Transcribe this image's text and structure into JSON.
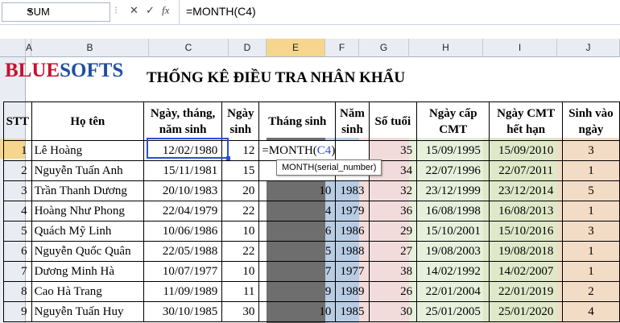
{
  "formula_bar": {
    "name_box": "SUM",
    "formula": "=MONTH(C4)",
    "icons": [
      "cancel-icon",
      "enter-icon",
      "function-icon"
    ]
  },
  "columns": [
    "A",
    "B",
    "C",
    "D",
    "E",
    "F",
    "G",
    "H",
    "I",
    "J"
  ],
  "selected_column": "E",
  "logo": {
    "part1": "BLUE",
    "part2": "SOFTS"
  },
  "title": "THỐNG KÊ ĐIỀU TRA NHÂN KHẨU",
  "headers": {
    "stt": "STT",
    "ho_ten": "Họ tên",
    "ngay_sinh_full": "Ngày, tháng, năm sinh",
    "ngay_sinh": "Ngày sinh",
    "thang_sinh": "Tháng sinh",
    "nam_sinh": "Năm sinh",
    "so_tuoi": "Số tuổi",
    "ngay_cap": "Ngày cấp CMT",
    "ngay_het_han": "Ngày CMT hết hạn",
    "sinh_vao_ngay": "Sinh vào ngày"
  },
  "rows": [
    {
      "stt": "1",
      "name": "Lê Hoàng",
      "dob": "12/02/1980",
      "day": "12",
      "month": "=MONTH(C4)",
      "year": "",
      "age": "35",
      "issue": "15/09/1995",
      "expire": "15/09/2010",
      "weekday": "3"
    },
    {
      "stt": "2",
      "name": "Nguyễn Tuấn Anh",
      "dob": "15/11/1981",
      "day": "15",
      "month": "",
      "year": "",
      "age": "34",
      "issue": "22/07/1996",
      "expire": "22/07/2011",
      "weekday": "1"
    },
    {
      "stt": "3",
      "name": "Trần Thanh Dương",
      "dob": "20/10/1983",
      "day": "20",
      "month": "10",
      "year": "1983",
      "age": "32",
      "issue": "23/12/1999",
      "expire": "23/12/2014",
      "weekday": "5"
    },
    {
      "stt": "4",
      "name": "Hoàng Như Phong",
      "dob": "22/04/1979",
      "day": "22",
      "month": "4",
      "year": "1979",
      "age": "36",
      "issue": "16/08/1998",
      "expire": "16/08/2013",
      "weekday": "1"
    },
    {
      "stt": "5",
      "name": "Quách Mỹ Linh",
      "dob": "10/06/1986",
      "day": "10",
      "month": "6",
      "year": "1986",
      "age": "29",
      "issue": "15/10/2001",
      "expire": "15/10/2016",
      "weekday": "3"
    },
    {
      "stt": "6",
      "name": "Nguyễn Quốc Quân",
      "dob": "22/05/1988",
      "day": "22",
      "month": "5",
      "year": "1988",
      "age": "27",
      "issue": "19/08/2003",
      "expire": "19/08/2018",
      "weekday": "1"
    },
    {
      "stt": "7",
      "name": "Dương Minh Hà",
      "dob": "10/07/1977",
      "day": "10",
      "month": "7",
      "year": "1977",
      "age": "38",
      "issue": "14/02/1992",
      "expire": "14/02/2007",
      "weekday": "1"
    },
    {
      "stt": "8",
      "name": "Cao Hà Trang",
      "dob": "11/09/1989",
      "day": "11",
      "month": "9",
      "year": "1989",
      "age": "26",
      "issue": "22/01/2004",
      "expire": "22/01/2019",
      "weekday": "2"
    },
    {
      "stt": "9",
      "name": "Nguyễn Tuấn Huy",
      "dob": "30/10/1985",
      "day": "30",
      "month": "10",
      "year": "1985",
      "age": "30",
      "issue": "25/01/2005",
      "expire": "25/01/2020",
      "weekday": "4"
    }
  ],
  "tooltip": "MONTH(serial_number)",
  "formula_parts": {
    "prefix": "=MONTH(",
    "ref": "C4",
    "suffix": ")"
  }
}
